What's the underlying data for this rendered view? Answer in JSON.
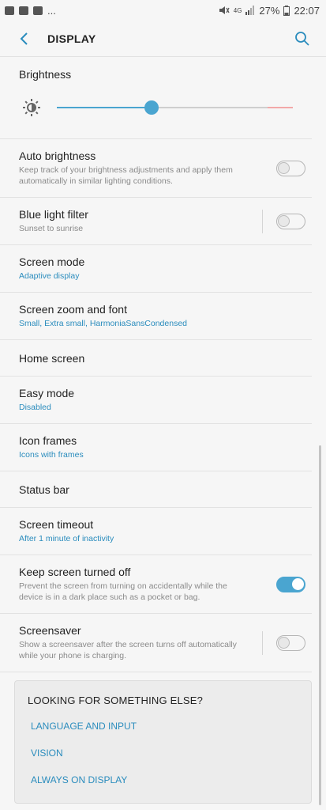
{
  "status_bar": {
    "left_icons": [
      "gallery-icon",
      "email-icon",
      "youtube-icon"
    ],
    "more": "...",
    "network": "4G",
    "battery": "27%",
    "time": "22:07"
  },
  "app_bar": {
    "title": "DISPLAY"
  },
  "brightness": {
    "label": "Brightness",
    "level": 0.4
  },
  "settings": [
    {
      "title": "Auto brightness",
      "subtitle": "Keep track of your brightness adjustments and apply them automatically in similar lighting conditions."
    },
    {
      "title": "Blue light filter",
      "subtitle": "Sunset to sunrise"
    },
    {
      "title": "Screen mode",
      "subtitle": "Adaptive display"
    },
    {
      "title": "Screen zoom and font",
      "subtitle": "Small, Extra small, HarmoniaSansCondensed"
    },
    {
      "title": "Home screen"
    },
    {
      "title": "Easy mode",
      "subtitle": "Disabled"
    },
    {
      "title": "Icon frames",
      "subtitle": "Icons with frames"
    },
    {
      "title": "Status bar"
    },
    {
      "title": "Screen timeout",
      "subtitle": "After 1 minute of inactivity"
    },
    {
      "title": "Keep screen turned off",
      "subtitle": "Prevent the screen from turning on accidentally while the device is in a dark place such as a pocket or bag."
    },
    {
      "title": "Screensaver",
      "subtitle": "Show a screensaver after the screen turns off automatically while your phone is charging."
    }
  ],
  "toggles": {
    "auto_brightness": false,
    "blue_light_filter": false,
    "keep_screen_off": true,
    "screensaver": false
  },
  "suggestions": {
    "heading": "LOOKING FOR SOMETHING ELSE?",
    "links": [
      "LANGUAGE AND INPUT",
      "VISION",
      "ALWAYS ON DISPLAY"
    ]
  },
  "colors": {
    "accent": "#4aa5d0",
    "link": "#2a8cbd"
  }
}
